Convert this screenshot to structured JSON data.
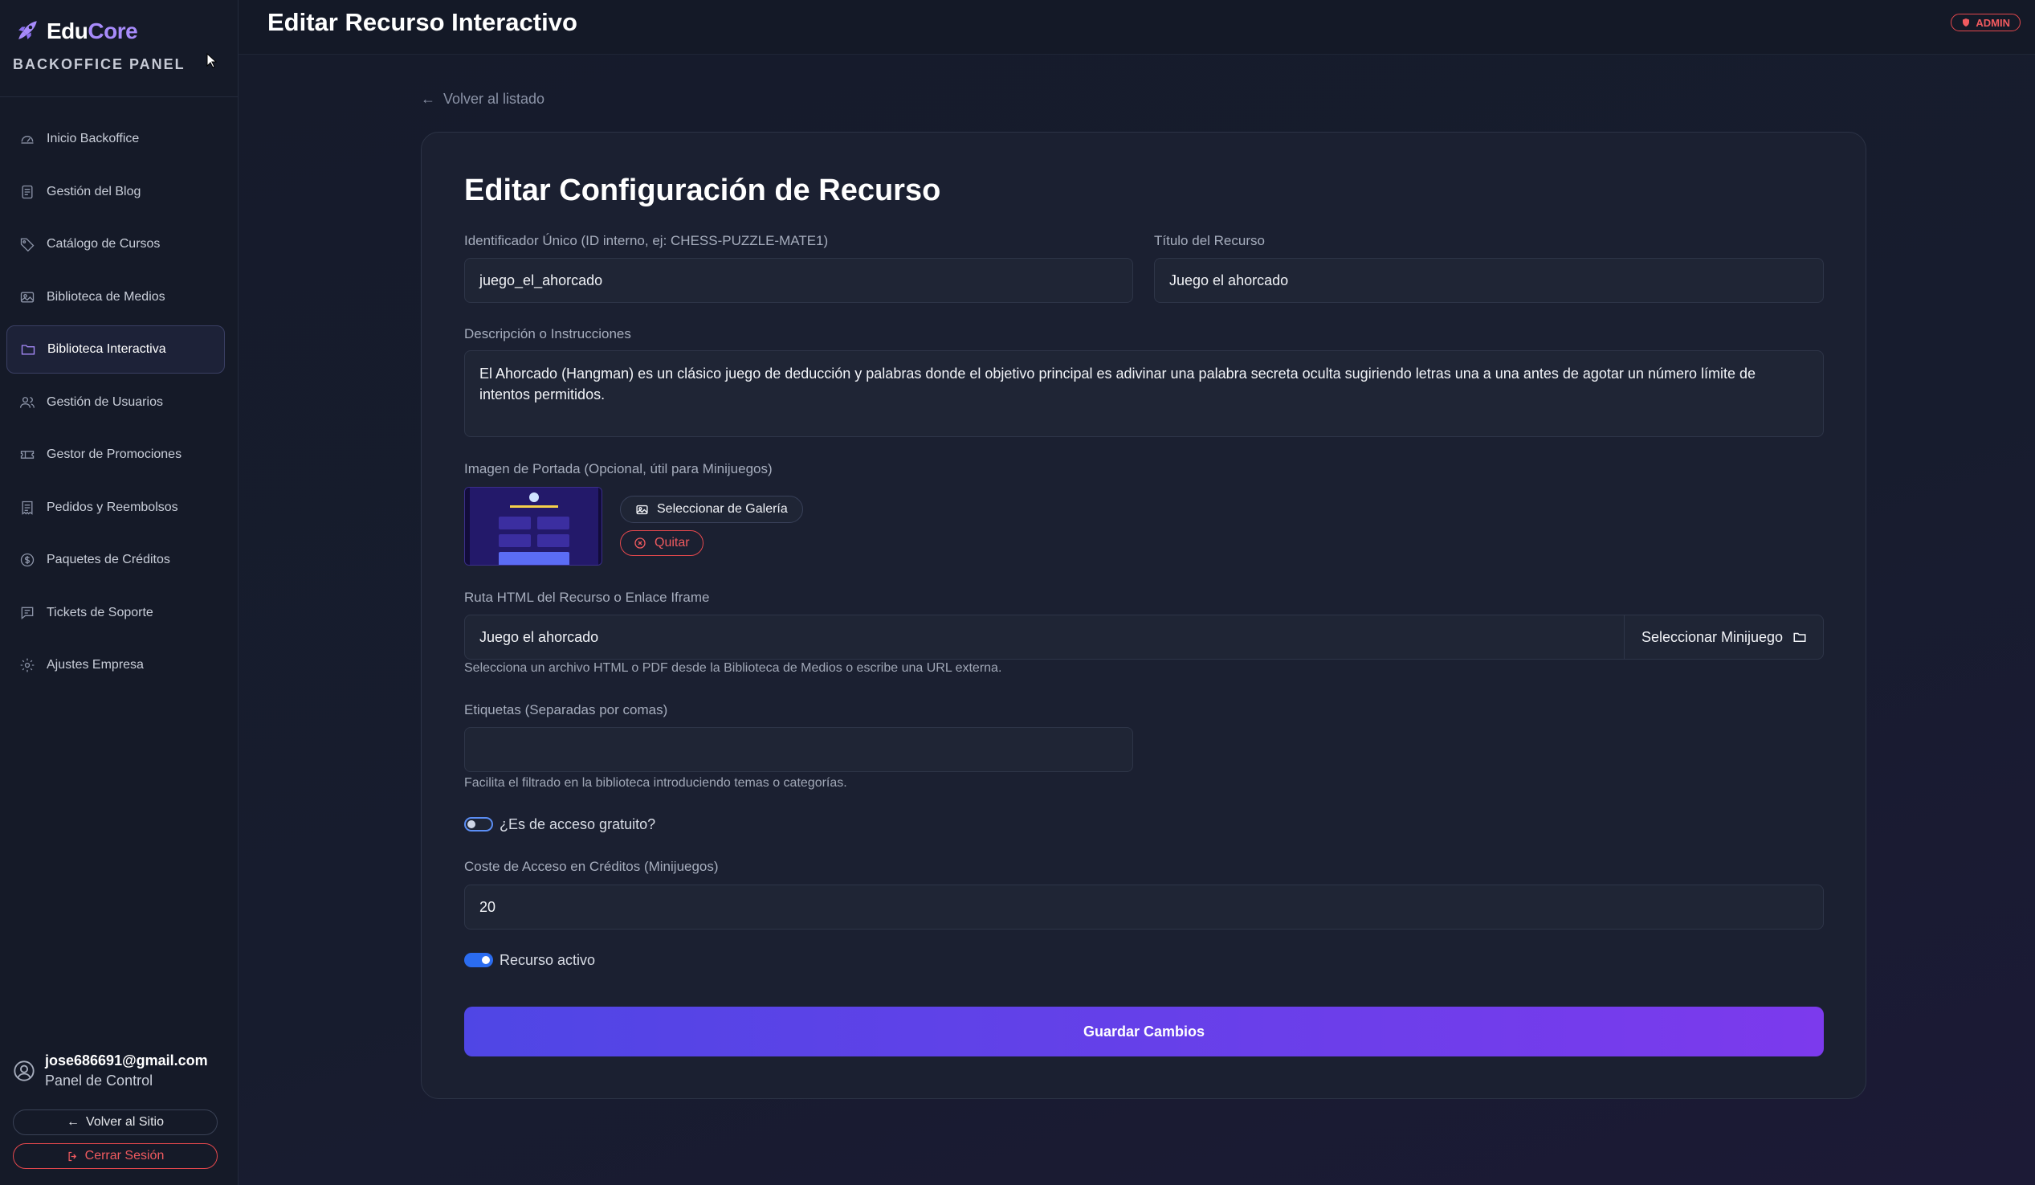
{
  "sidebar": {
    "brand_prefix": "Edu",
    "brand_suffix": "Core",
    "subtitle": "BACKOFFICE PANEL",
    "items": [
      {
        "label": "Inicio Backoffice",
        "icon": "dashboard-icon"
      },
      {
        "label": "Gestión del Blog",
        "icon": "document-icon"
      },
      {
        "label": "Catálogo de Cursos",
        "icon": "tag-icon"
      },
      {
        "label": "Biblioteca de Medios",
        "icon": "image-icon"
      },
      {
        "label": "Biblioteca Interactiva",
        "icon": "folder-icon",
        "active": true
      },
      {
        "label": "Gestión de Usuarios",
        "icon": "users-icon"
      },
      {
        "label": "Gestor de Promociones",
        "icon": "ticket-icon"
      },
      {
        "label": "Pedidos y Reembolsos",
        "icon": "receipt-icon"
      },
      {
        "label": "Paquetes de Créditos",
        "icon": "dollar-circle-icon"
      },
      {
        "label": "Tickets de Soporte",
        "icon": "message-icon"
      },
      {
        "label": "Ajustes Empresa",
        "icon": "gear-icon"
      }
    ],
    "user_email": "jose686691@gmail.com",
    "user_role": "Panel de Control",
    "back_to_site": "Volver al Sitio",
    "logout": "Cerrar Sesión"
  },
  "header": {
    "title": "Editar Recurso Interactivo",
    "badge": "ADMIN"
  },
  "main": {
    "back_link": "Volver al listado",
    "form_title": "Editar Configuración de Recurso",
    "identifier_label": "Identificador Único (ID interno, ej: CHESS-PUZZLE-MATE1)",
    "identifier_value": "juego_el_ahorcado",
    "title_label": "Título del Recurso",
    "title_value": "Juego el ahorcado",
    "description_label": "Descripción o Instrucciones",
    "description_value": "El Ahorcado (Hangman) es un clásico juego de deducción y palabras donde el objetivo principal es adivinar una palabra secreta oculta sugiriendo letras una a una antes de agotar un número límite de intentos permitidos.",
    "cover_label": "Imagen de Portada (Opcional, útil para Minijuegos)",
    "select_gallery": "Seleccionar de Galería",
    "remove": "Quitar",
    "route_label": "Ruta HTML del Recurso o Enlace Iframe",
    "route_value": "Juego el ahorcado",
    "select_minigame": "Seleccionar Minijuego",
    "route_hint": "Selecciona un archivo HTML o PDF desde la Biblioteca de Medios o escribe una URL externa.",
    "tags_label": "Etiquetas (Separadas por comas)",
    "tags_value": "",
    "tags_hint": "Facilita el filtrado en la biblioteca introduciendo temas o categorías.",
    "free_access_label": "¿Es de acceso gratuito?",
    "free_access": false,
    "cost_label": "Coste de Acceso en Créditos (Minijuegos)",
    "cost_value": "20",
    "active_label": "Recurso activo",
    "active": true,
    "save_button": "Guardar Cambios"
  },
  "colors": {
    "accent": "#a78bfa",
    "danger": "#f05a5f",
    "toggle_on": "#2b6cf0",
    "button_gradient_start": "#4f46e5",
    "button_gradient_end": "#7c3aed"
  }
}
